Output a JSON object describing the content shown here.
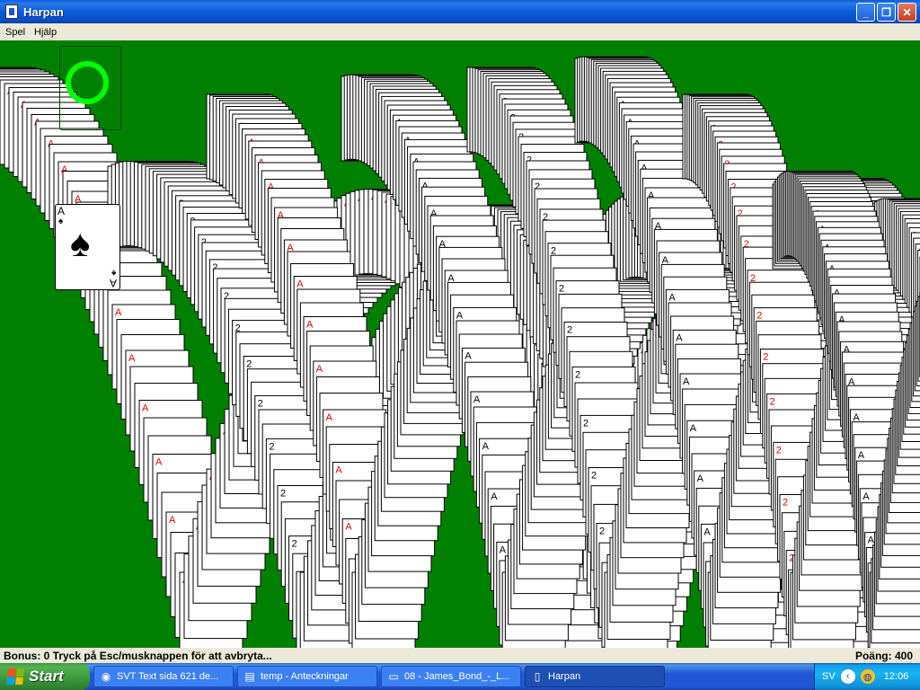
{
  "window": {
    "title": "Harpan",
    "minimize_glyph": "_",
    "maximize_glyph": "❐",
    "close_glyph": "✕"
  },
  "menu": {
    "items": [
      "Spel",
      "Hjälp"
    ]
  },
  "game": {
    "background_color": "#008000",
    "redeal_indicator_color": "#00ff00",
    "top_card": {
      "rank": "A",
      "suit": "♠",
      "suit_name": "spades"
    },
    "cascade_labels": {
      "red_ace": "A",
      "black_ace": "A",
      "two": "2"
    }
  },
  "status": {
    "left": "Bonus: 0  Tryck på Esc/musknappen för att avbryta...",
    "right": "Poäng: 400"
  },
  "taskbar": {
    "start_label": "Start",
    "tasks": [
      {
        "label": "SVT Text sida 621 de...",
        "icon": "browser-icon",
        "active": false
      },
      {
        "label": "temp - Anteckningar",
        "icon": "notepad-icon",
        "active": false
      },
      {
        "label": "08 - James_Bond_-_L...",
        "icon": "folder-icon",
        "active": false
      },
      {
        "label": "Harpan",
        "icon": "cards-icon",
        "active": true
      }
    ],
    "tray": {
      "language": "SV",
      "clock": "12:06"
    }
  }
}
